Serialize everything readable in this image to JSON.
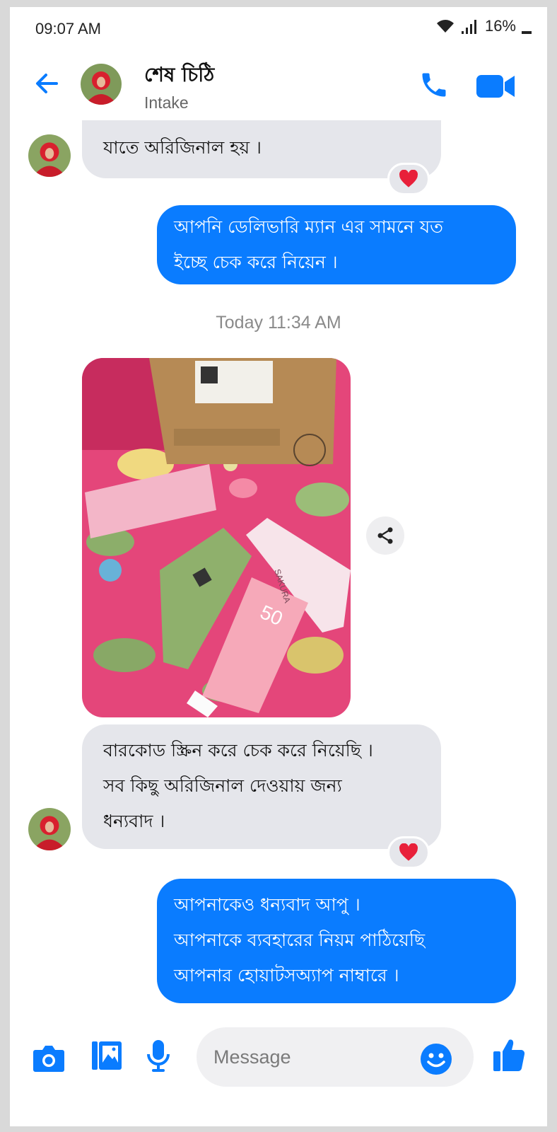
{
  "status_bar": {
    "time": "09:07 AM",
    "battery": "16%"
  },
  "header": {
    "name": "শেষ চিঠি",
    "subtitle": "Intake"
  },
  "messages": [
    {
      "side": "in",
      "text": "যাতে অরিজিনাল হয় ।",
      "reaction": "heart"
    },
    {
      "side": "out",
      "lines": [
        "আপনি ডেলিভারি ম্যান এর সামনে যত",
        "ইচ্ছে চেক করে নিয়েন ।"
      ]
    },
    {
      "side": "in",
      "lines": [
        "বারকোড স্ক্রিন করে চেক করে নিয়েছি ।",
        "সব কিছু অরিজিনাল দেওয়ায় জন্য",
        "ধন্যবাদ ।"
      ],
      "reaction": "heart"
    },
    {
      "side": "out",
      "lines": [
        "আপনাকেও ধন্যবাদ আপু ।",
        "আপনাকে ব্যবহারের নিয়ম পাঠিয়েছি",
        "আপনার হোয়াটসঅ্যাপ নাম্বারে ।"
      ]
    }
  ],
  "timestamp": "Today 11:34 AM",
  "photo_text": {
    "spf": "50",
    "brand": "SAKURA"
  },
  "composer": {
    "placeholder": "Message"
  },
  "colors": {
    "accent": "#0a7cff",
    "incoming_bubble": "#e5e6eb",
    "heart": "#e8203a"
  },
  "icons": [
    "back-arrow-icon",
    "phone-icon",
    "video-camera-icon",
    "heart-icon",
    "share-icon",
    "camera-icon",
    "gallery-icon",
    "microphone-icon",
    "emoji-icon",
    "thumbs-up-icon"
  ]
}
